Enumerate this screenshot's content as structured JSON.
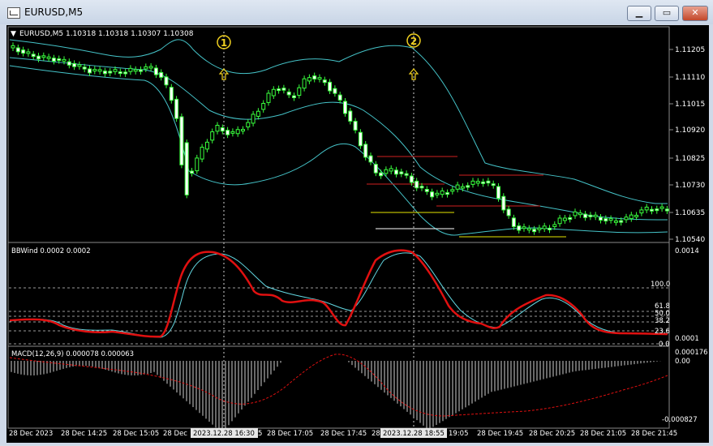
{
  "window": {
    "title": "EURUSD,M5",
    "buttons": {
      "minimize": "▁",
      "maximize": "▭",
      "close": "✕"
    }
  },
  "colors": {
    "background": "#000000",
    "bullish": "#39ff3d",
    "bands": "#45c3c8",
    "indicator_fast": "#e01010",
    "indicator_slow": "#62d6e0",
    "grid": "#bfbfbf",
    "level_red": "#d02020",
    "level_yellow": "#e6e600",
    "marker": "#f0d020"
  },
  "main": {
    "header": "EURUSD,M5  1.10318 1.10318 1.10307 1.10308",
    "price_labels": [
      "1.11205",
      "1.11110",
      "1.11015",
      "1.10920",
      "1.10825",
      "1.10730",
      "1.10635",
      "1.10540"
    ],
    "markers": [
      {
        "label": "1"
      },
      {
        "label": "2"
      }
    ]
  },
  "bbw": {
    "header": "BBWind 0.0002 0.0002",
    "labels": [
      "0.0014",
      "100.0",
      "61.8",
      "50.0",
      "38.2",
      "23.6",
      "0.0001",
      "0.0"
    ]
  },
  "macd": {
    "header": "MACD(12,26,9) 0.000078 0.000063",
    "labels": [
      "0.000176",
      "0.00",
      "-0.000827"
    ]
  },
  "time_axis": {
    "labels": [
      "28 Dec 2023",
      "28 Dec 14:25",
      "28 Dec 15:05",
      "28 Dec",
      "2023.12.28 16:30",
      "5",
      "28 Dec 17:05",
      "28 Dec 17:45",
      "28",
      "2023.12.28 18:55",
      "19:05",
      "28 Dec 19:45",
      "28 Dec 20:25",
      "28 Dec 21:05",
      "28 Dec 21:45"
    ]
  }
}
